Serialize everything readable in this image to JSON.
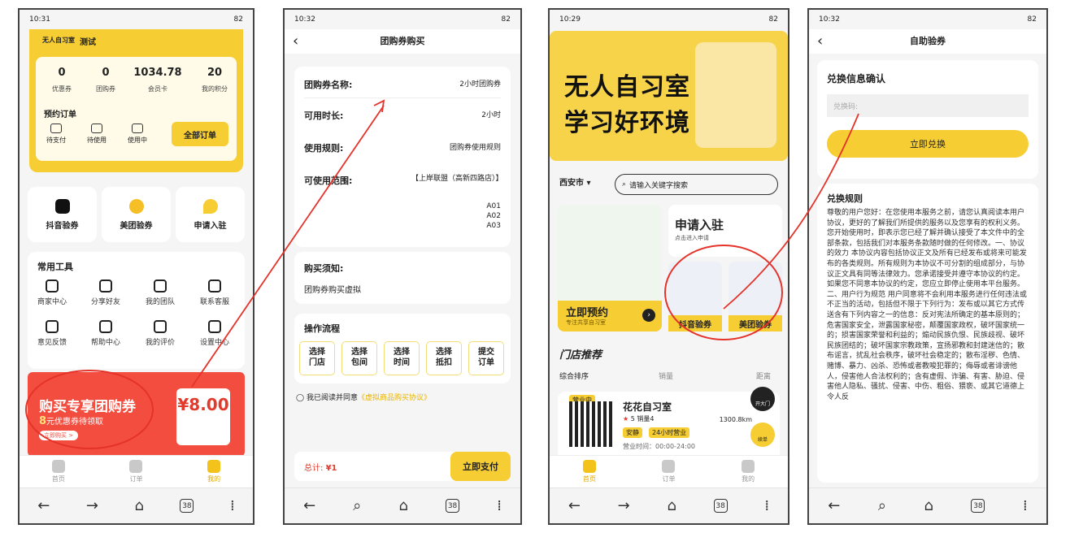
{
  "p1": {
    "time": "10:31",
    "battery": "82",
    "brand": "无人自习室",
    "test": "测试",
    "stats": [
      {
        "v": "0",
        "l": "优惠券"
      },
      {
        "v": "0",
        "l": "团购券"
      },
      {
        "v": "1034.78",
        "l": "会员卡"
      },
      {
        "v": "20",
        "l": "我的积分"
      }
    ],
    "pre_title": "预约订单",
    "pre_items": [
      "待支付",
      "待使用",
      "使用中"
    ],
    "all_orders": "全部订单",
    "apps": [
      "抖音验券",
      "美团验券",
      "申请入驻"
    ],
    "tools_title": "常用工具",
    "tools": [
      "商家中心",
      "分享好友",
      "我的团队",
      "联系客服",
      "意见反馈",
      "帮助中心",
      "我的评价",
      "设置中心"
    ],
    "banner": {
      "title": "购买专享团购券",
      "amount": "8",
      "sub": "元优惠券待领取",
      "btn": "立即购买 >",
      "price": "¥8.00"
    },
    "tabs": [
      "首页",
      "订单",
      "我的"
    ]
  },
  "p2": {
    "time": "10:32",
    "battery": "82",
    "title": "团购券购买",
    "rows": [
      {
        "k": "团购券名称:",
        "v": "2小时团购券"
      },
      {
        "k": "可用时长:",
        "v": "2小时"
      },
      {
        "k": "使用规则:",
        "v": "团购券使用规则"
      },
      {
        "k": "可使用范围:",
        "v": "【上岸联盟（高新四路店）】"
      }
    ],
    "seats": [
      "A01",
      "A02",
      "A03"
    ],
    "notice_title": "购买须知:",
    "notice_text": "团购券购买虚拟",
    "flow_title": "操作流程",
    "steps": [
      [
        "选择",
        "门店"
      ],
      [
        "选择",
        "包间"
      ],
      [
        "选择",
        "时间"
      ],
      [
        "选择",
        "抵扣"
      ],
      [
        "提交",
        "订单"
      ]
    ],
    "agree": "我已阅读并同意",
    "agree_link": "《虚拟商品购买协议》",
    "total_label": "总计:",
    "total": "¥1",
    "pay": "立即支付"
  },
  "p3": {
    "time": "10:29",
    "battery": "82",
    "hero1": "无人自习室",
    "hero2": "学习好环境",
    "city": "西安市",
    "search_ph": "请输入关键字搜索",
    "book": "立即预约",
    "book_sub": "专注共享自习室",
    "join": "申请入驻",
    "join_sub": "点击进入申请",
    "v1": "抖音验券",
    "v2": "美团验券",
    "store_title": "门店推荐",
    "sort": [
      "综合排序",
      "销量",
      "距离"
    ],
    "store": {
      "status": "营业中",
      "name": "花花自习室",
      "stars": "5",
      "sales": "销量4",
      "dist": "1300.8km",
      "tags": [
        "安静",
        "24小时营业"
      ],
      "hours": "营业时间：00:00-24:00",
      "open": "开大门",
      "renew": "续单"
    },
    "tabs": [
      "首页",
      "订单",
      "我的"
    ]
  },
  "p4": {
    "time": "10:32",
    "battery": "82",
    "title": "自助验券",
    "ex_title": "兑换信息确认",
    "ex_ph": "兑换码:",
    "ex_btn": "立即兑换",
    "rules_title": "兑换规则",
    "rules_text": "尊敬的用户您好：在您使用本服务之前，请您认真阅读本用户协议，更好的了解我们所提供的服务以及您享有的权利义务。您开始使用时，即表示您已经了解并确认接受了本文件中的全部条款，包括我们对本服务条款随时做的任何修改。一、协议的效力 本协议内容包括协议正文及所有已经发布或将来可能发布的各类规则。所有规则为本协议不可分割的组成部分，与协议正文具有同等法律效力。您承诺接受并遵守本协议的约定。如果您不同意本协议的约定，您应立即停止使用本平台服务。二、用户行为规范 用户同意将不会利用本服务进行任何违法或不正当的活动，包括但不限于下列行为：发布或以其它方式传送含有下列内容之一的信息：反对宪法所确定的基本原则的；危害国家安全，泄露国家秘密，颠覆国家政权，破坏国家统一的；损害国家荣誉和利益的；煽动民族仇恨、民族歧视、破坏民族团结的；破坏国家宗教政策，宣扬邪教和封建迷信的；散布谣言，扰乱社会秩序，破坏社会稳定的；散布淫秽、色情、赌博、暴力、凶杀、恐怖或者教唆犯罪的；侮辱或者诽谤他人，侵害他人合法权利的；含有虚假、诈骗、有害、胁迫、侵害他人隐私、骚扰、侵害、中伤、粗俗、猥亵、或其它道德上令人反"
  },
  "nav_tabs": "38",
  "colors": {
    "brand": "#f6cd33",
    "annotation": "#e5322a"
  }
}
